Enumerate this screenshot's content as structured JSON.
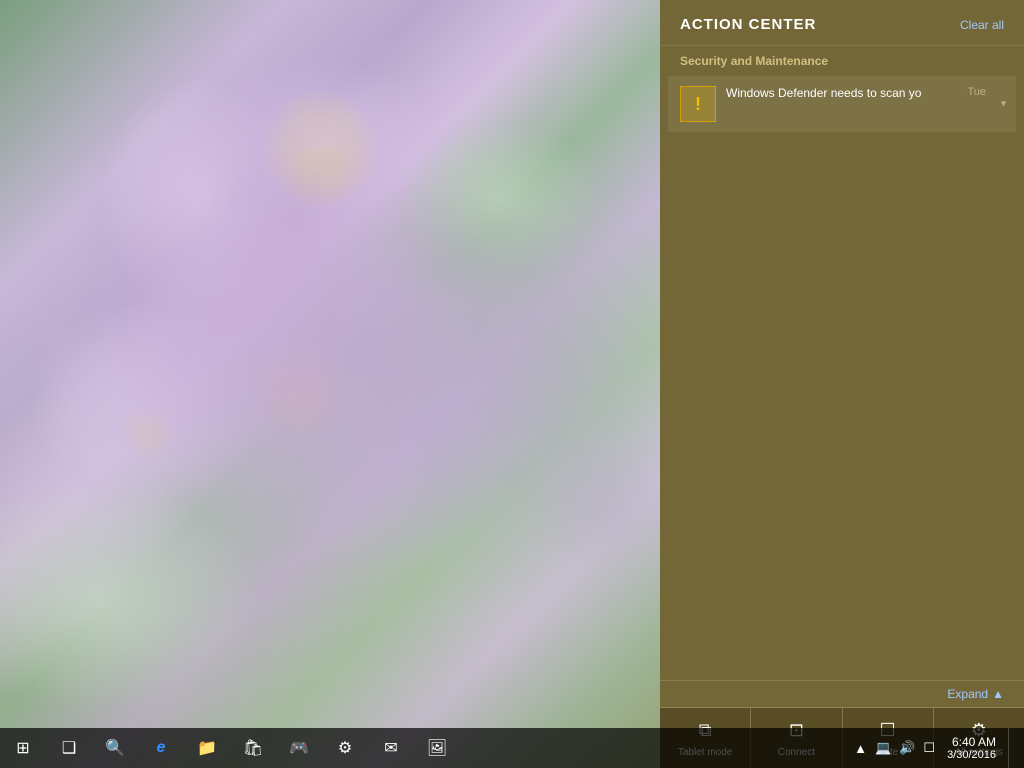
{
  "desktop": {
    "alt": "Flower wallpaper"
  },
  "action_center": {
    "title": "ACTION CENTER",
    "clear_all_label": "Clear all",
    "notification_groups": [
      {
        "id": "security-maintenance",
        "label": "Security and Maintenance",
        "notifications": [
          {
            "id": "defender",
            "icon": "warning",
            "text": "Windows Defender needs to scan yo",
            "time": "Tue",
            "has_chevron": true
          }
        ]
      }
    ],
    "expand_label": "Expand",
    "expand_icon": "▲",
    "quick_actions": [
      {
        "id": "tablet-mode",
        "icon": "⊞",
        "label": "Tablet mode"
      },
      {
        "id": "connect",
        "icon": "⊡",
        "label": "Connect"
      },
      {
        "id": "note",
        "icon": "☐",
        "label": "Note"
      },
      {
        "id": "all-settings",
        "icon": "⚙",
        "label": "All settings"
      }
    ]
  },
  "taskbar": {
    "buttons": [
      {
        "id": "start",
        "icon": "⊞",
        "label": "Start"
      },
      {
        "id": "task-view",
        "icon": "❑",
        "label": "Task View"
      },
      {
        "id": "search",
        "icon": "🔍",
        "label": "Search"
      },
      {
        "id": "edge",
        "icon": "e",
        "label": "Microsoft Edge"
      },
      {
        "id": "explorer",
        "icon": "📁",
        "label": "File Explorer"
      },
      {
        "id": "store",
        "icon": "🛍",
        "label": "Store"
      },
      {
        "id": "game",
        "icon": "🎮",
        "label": "Game"
      },
      {
        "id": "settings",
        "icon": "⚙",
        "label": "Settings"
      },
      {
        "id": "mail",
        "icon": "✉",
        "label": "Mail"
      },
      {
        "id": "app",
        "icon": "🖼",
        "label": "Photos"
      }
    ],
    "tray": {
      "icons": [
        "▲",
        "🔊",
        "💻",
        "📶"
      ],
      "time": "6:40 AM",
      "date": "3/30/2016"
    }
  }
}
